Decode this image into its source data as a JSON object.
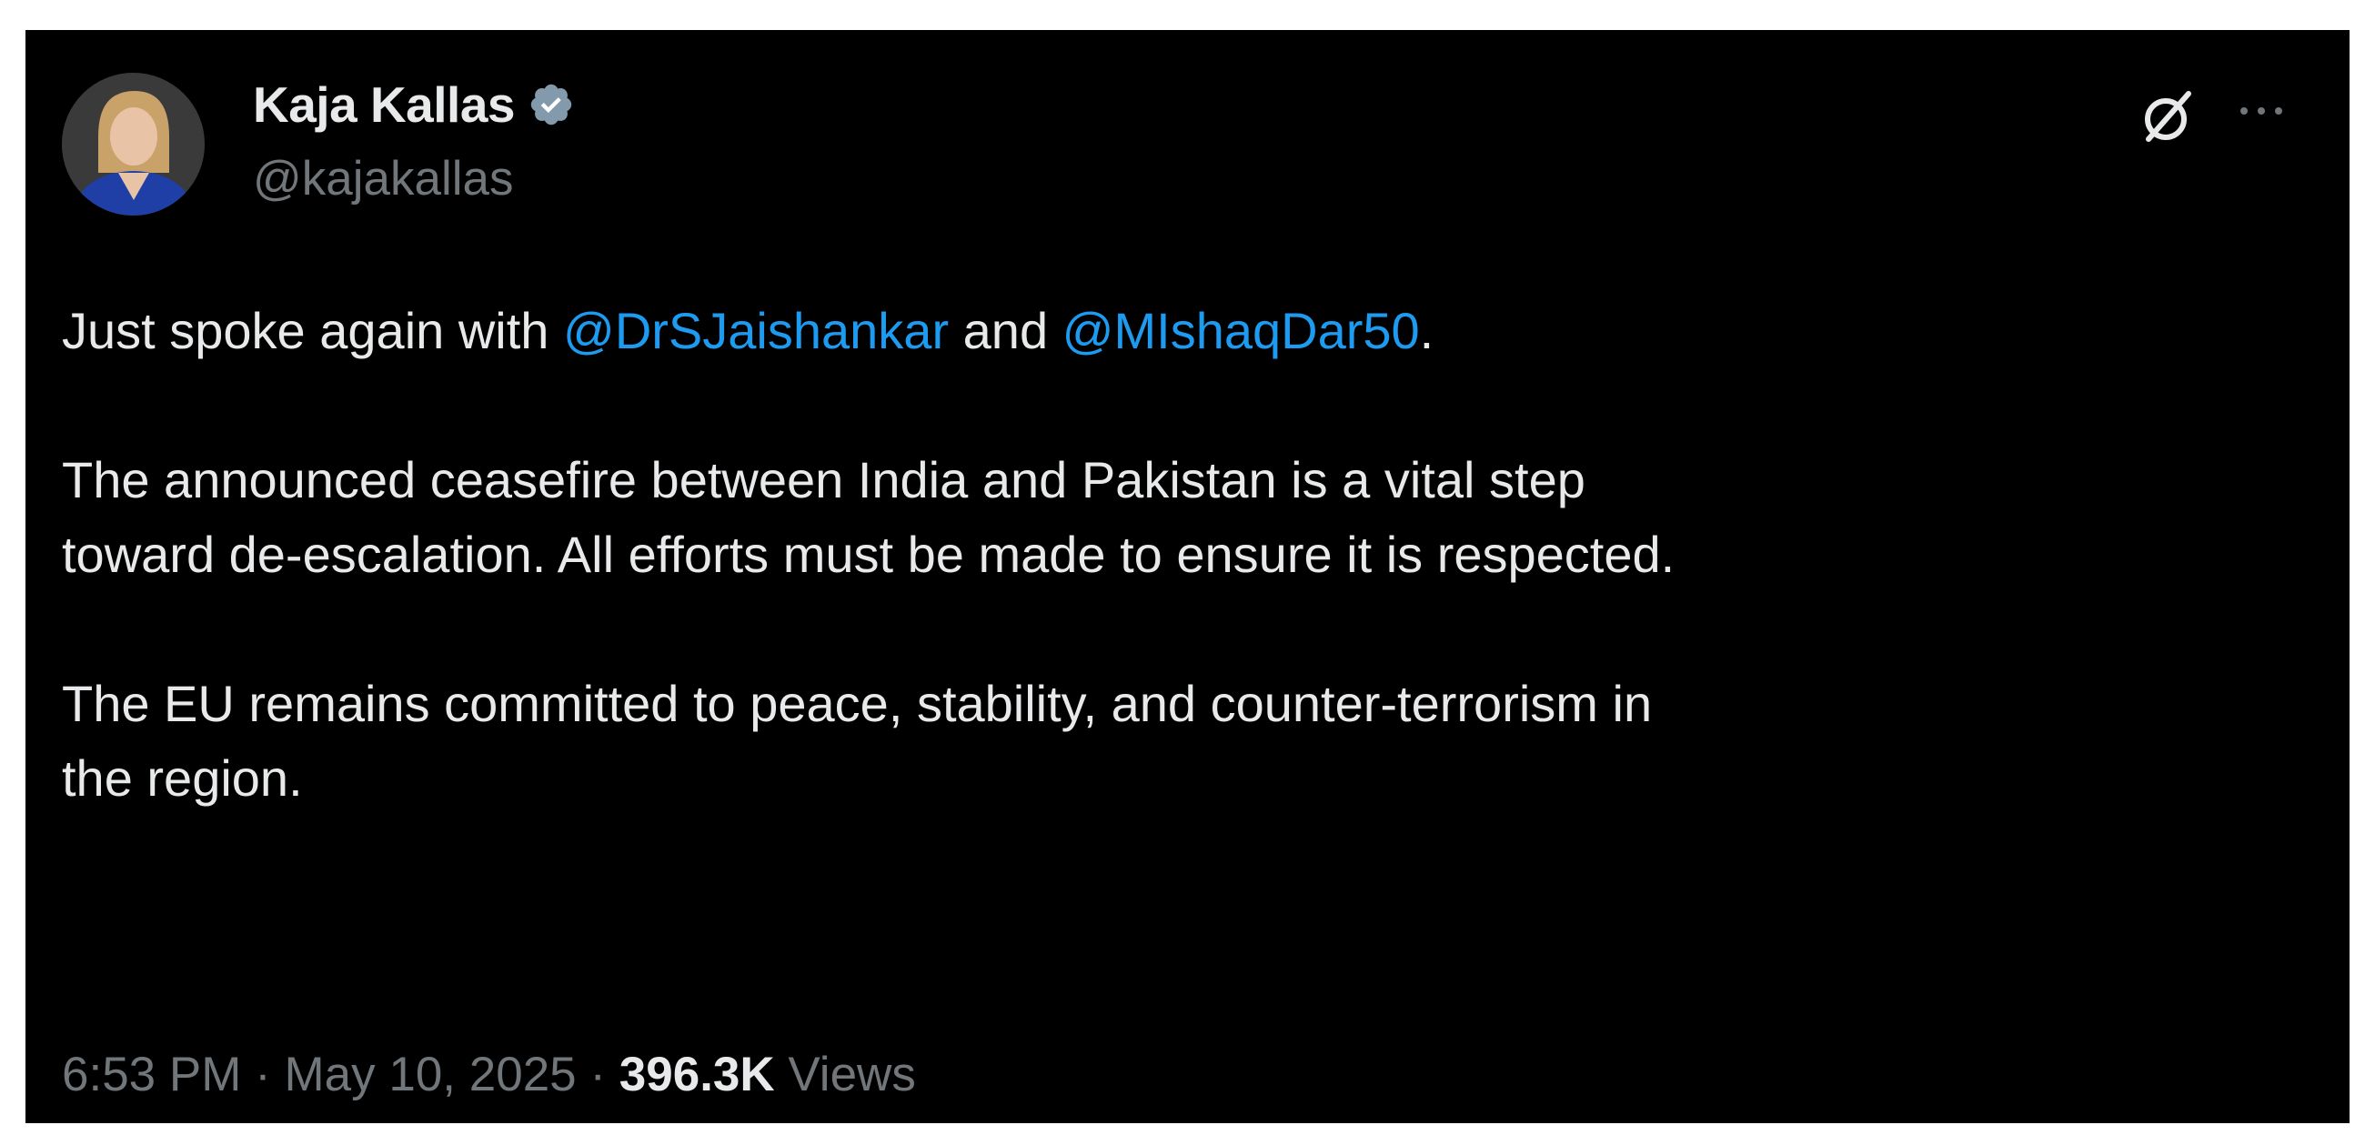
{
  "author": {
    "name": "Kaja Kallas",
    "handle": "@kajakallas",
    "verified_icon": "verified-badge-icon",
    "avatar_icon": "profile-photo"
  },
  "actions": {
    "grok_icon": "grok-slash-circle-icon",
    "more_icon": "more-ellipsis-icon"
  },
  "tweet": {
    "line1_prefix": "Just spoke again with ",
    "mention1": "@DrSJaishankar",
    "line1_mid": " and ",
    "mention2": "@MIshaqDar50",
    "line1_suffix": ".",
    "paragraph2": "The announced ceasefire between India and Pakistan is a vital step\ntoward de-escalation. All efforts must be made to ensure it is respected.",
    "paragraph3": "The EU remains committed to peace, stability, and counter-terrorism in\nthe region."
  },
  "meta": {
    "time": "6:53 PM",
    "separator": " · ",
    "date": "May 10, 2025",
    "views_count": "396.3K",
    "views_label": " Views"
  },
  "colors": {
    "background": "#000000",
    "text": "#e7e9ea",
    "secondary": "#71767b",
    "accent": "#1d9bf0"
  }
}
